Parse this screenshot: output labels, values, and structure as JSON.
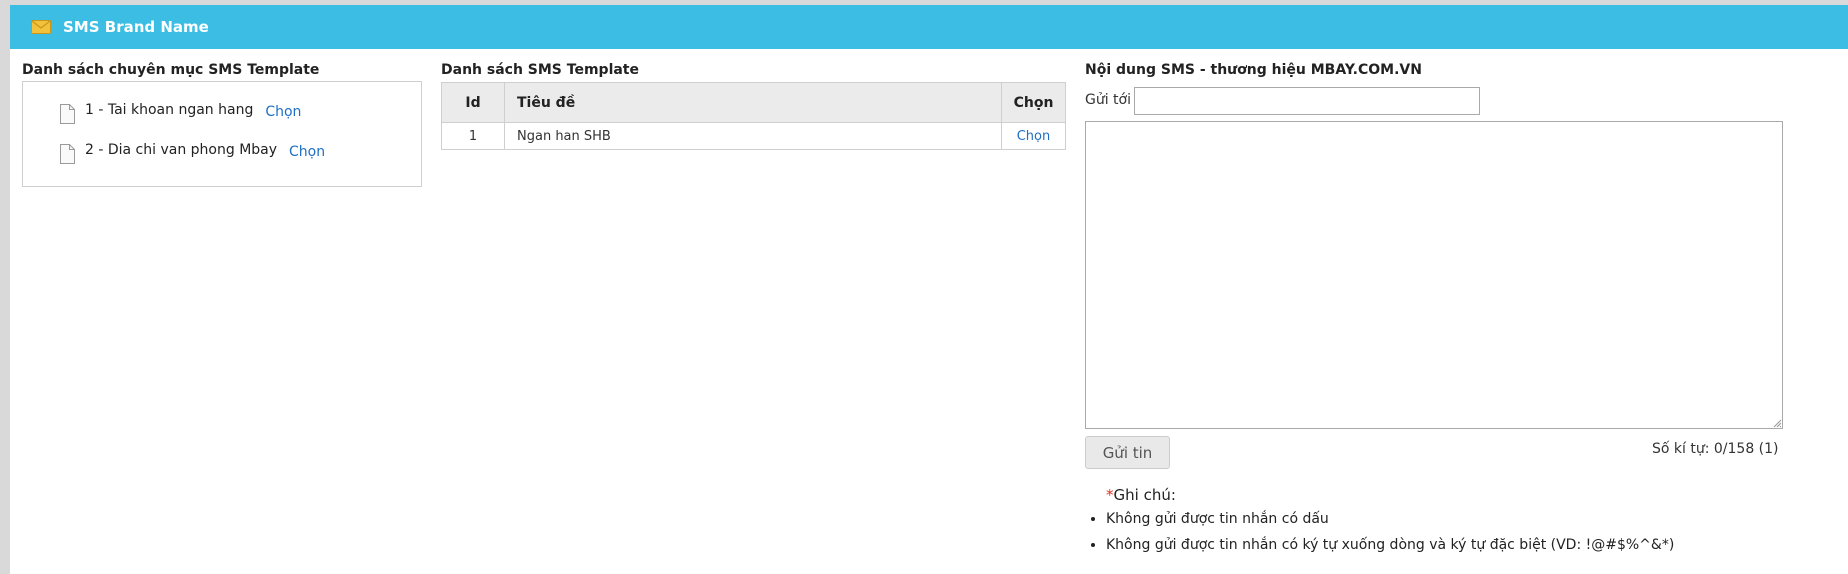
{
  "header": {
    "title": "SMS Brand Name",
    "icon": "mail-icon"
  },
  "categories": {
    "title": "Danh sách chuyên mục SMS Template",
    "items": [
      {
        "label": "1 - Tai khoan ngan hang",
        "link": "Chọn"
      },
      {
        "label": "2 - Dia chi van phong Mbay",
        "link": "Chọn"
      }
    ]
  },
  "templates": {
    "title": "Danh sách SMS Template",
    "columns": [
      "Id",
      "Tiêu đề",
      "Chọn"
    ],
    "rows": [
      {
        "id": "1",
        "title": "Ngan han SHB",
        "link": "Chọn"
      }
    ]
  },
  "sms": {
    "title": "Nội dung SMS - thương hiệu MBAY.COM.VN",
    "send_to_label": "Gửi tới",
    "send_to_value": "",
    "message_value": "",
    "send_button": "Gửi tin",
    "counter": "Số kí tự: 0/158 (1)",
    "note_star": "*",
    "note_title": "Ghi chú:",
    "notes": [
      "Không gửi được tin nhắn có dấu",
      "Không gửi được tin nhắn có ký tự xuống dòng và ký tự đặc biệt (VD: !@#$%^&*)"
    ]
  },
  "colors": {
    "header_bg": "#3cbde4",
    "link": "#1f6fc4",
    "star": "#e0301e"
  }
}
